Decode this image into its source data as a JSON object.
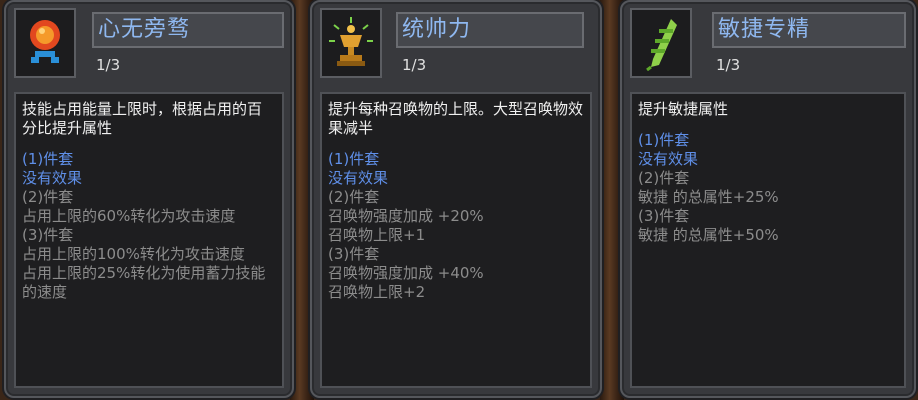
{
  "cards": [
    {
      "title": "心无旁骛",
      "level": "1/3",
      "icon": "orange-red-orb-icon",
      "description": "技能占用能量上限时，根据占用的百分比提升属性",
      "tiers": [
        {
          "label": "(1)件套",
          "effect": "没有效果",
          "active": true
        },
        {
          "label": "(2)件套",
          "effect": "占用上限的60%转化为攻击速度",
          "active": false
        },
        {
          "label": "(3)件套",
          "effect": "占用上限的100%转化为攻击速度\n占用上限的25%转化为使用蓄力技能的速度",
          "active": false
        }
      ]
    },
    {
      "title": "统帅力",
      "level": "1/3",
      "icon": "golden-chalice-icon",
      "description": "提升每种召唤物的上限。大型召唤物效果减半",
      "tiers": [
        {
          "label": "(1)件套",
          "effect": "没有效果",
          "active": true
        },
        {
          "label": "(2)件套",
          "effect": "召唤物强度加成 +20%\n召唤物上限+1",
          "active": false
        },
        {
          "label": "(3)件套",
          "effect": "召唤物强度加成 +40%\n召唤物上限+2",
          "active": false
        }
      ]
    },
    {
      "title": "敏捷专精",
      "level": "1/3",
      "icon": "green-feather-icon",
      "description": "提升敏捷属性",
      "tiers": [
        {
          "label": "(1)件套",
          "effect": "没有效果",
          "active": true
        },
        {
          "label": "(2)件套",
          "effect": "敏捷 的总属性+25%",
          "active": false
        },
        {
          "label": "(3)件套",
          "effect": "敏捷 的总属性+50%",
          "active": false
        }
      ]
    }
  ]
}
